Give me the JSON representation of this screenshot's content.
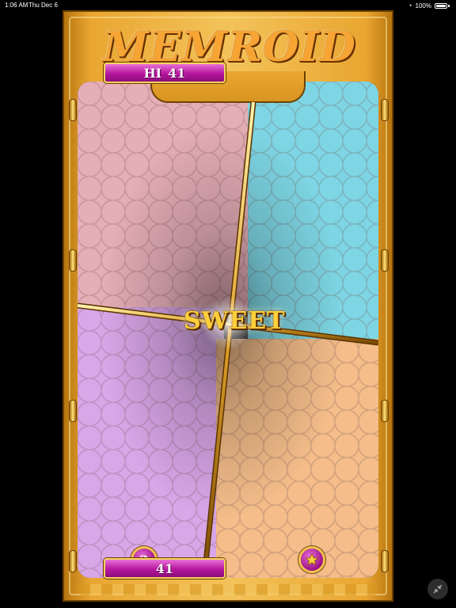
{
  "status_bar": {
    "time": "1:06 AM",
    "date": "Thu Dec 6",
    "battery": "100%"
  },
  "game": {
    "title": "MEMROID",
    "hi_label": "HI",
    "hi_score": "41",
    "feedback": "SWEET",
    "level": "2",
    "score": "41"
  },
  "colors": {
    "pink_tile": "#e6aeb7",
    "cyan_tile": "#7ed6e4",
    "purple_tile": "#d9a6e8",
    "orange_tile": "#f4bd8a",
    "frame_gold": "#e9a631",
    "pill_magenta": "#b5169e"
  },
  "icons": {
    "star": "star-icon",
    "collapse": "collapse-icon",
    "wifi": "wifi-icon",
    "battery": "battery-icon"
  }
}
